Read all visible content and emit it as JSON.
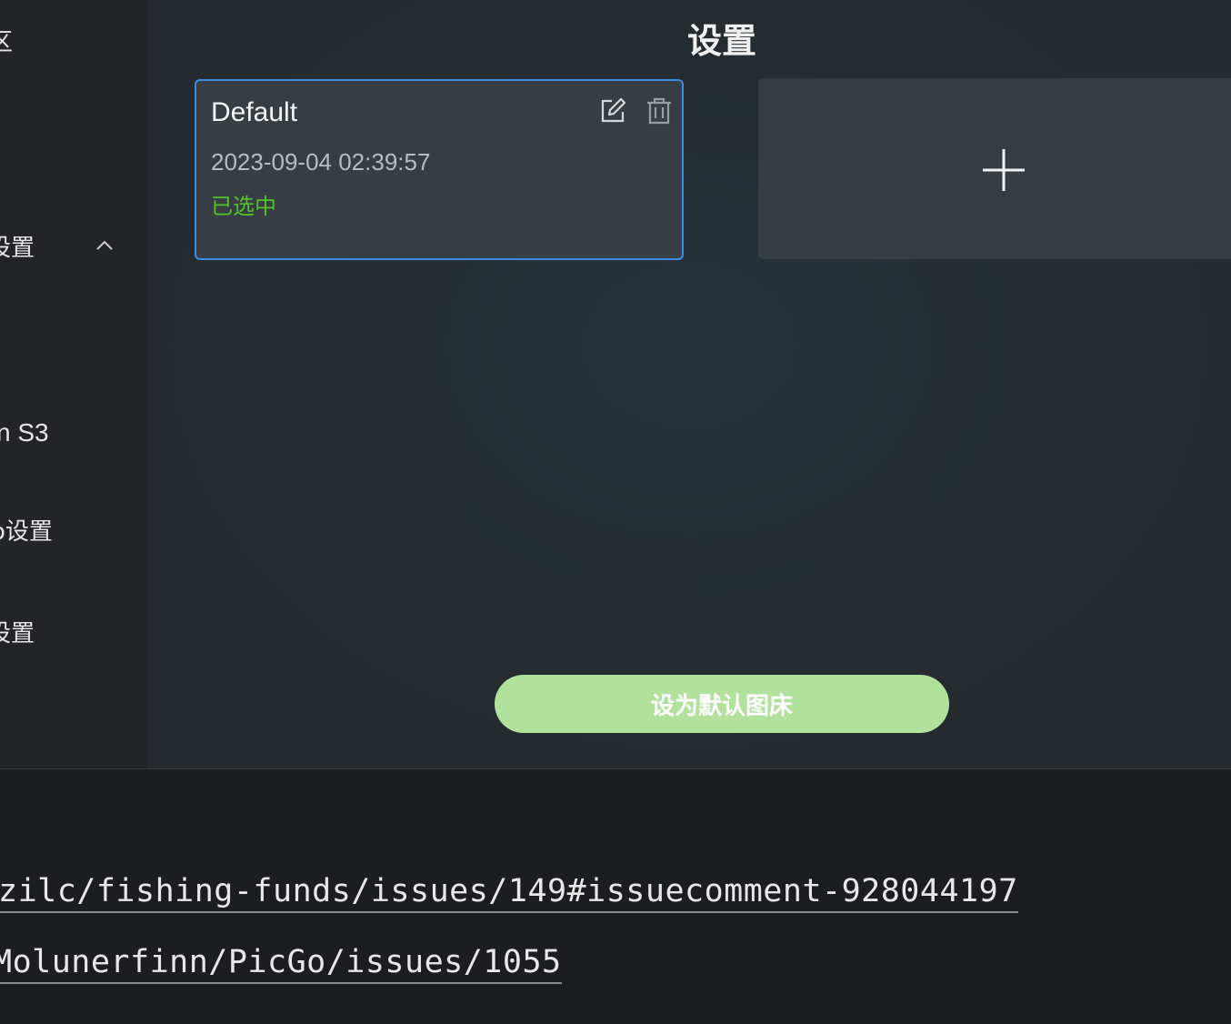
{
  "sidebar": {
    "items": [
      {
        "label": "区"
      },
      {
        "label": "设置"
      },
      {
        "label": "n S3"
      },
      {
        "label": "设置",
        "prefix": "o"
      },
      {
        "label": "设置"
      }
    ]
  },
  "main": {
    "title": "设置",
    "config_card": {
      "name": "Default",
      "date": "2023-09-04 02:39:57",
      "status": "已选中"
    },
    "set_default_button": "设为默认图床"
  },
  "links": [
    {
      "text": "zilc/fishing-funds/issues/149#issuecomment-928044197"
    },
    {
      "text": "Molunerfinn/PicGo/issues/1055"
    }
  ],
  "colors": {
    "accent_blue": "#3a8ee6",
    "selected_green": "#56c02a",
    "button_green": "#b2e19d"
  },
  "icons": [
    "chevron-up-icon",
    "edit-icon",
    "trash-icon",
    "plus-icon"
  ]
}
